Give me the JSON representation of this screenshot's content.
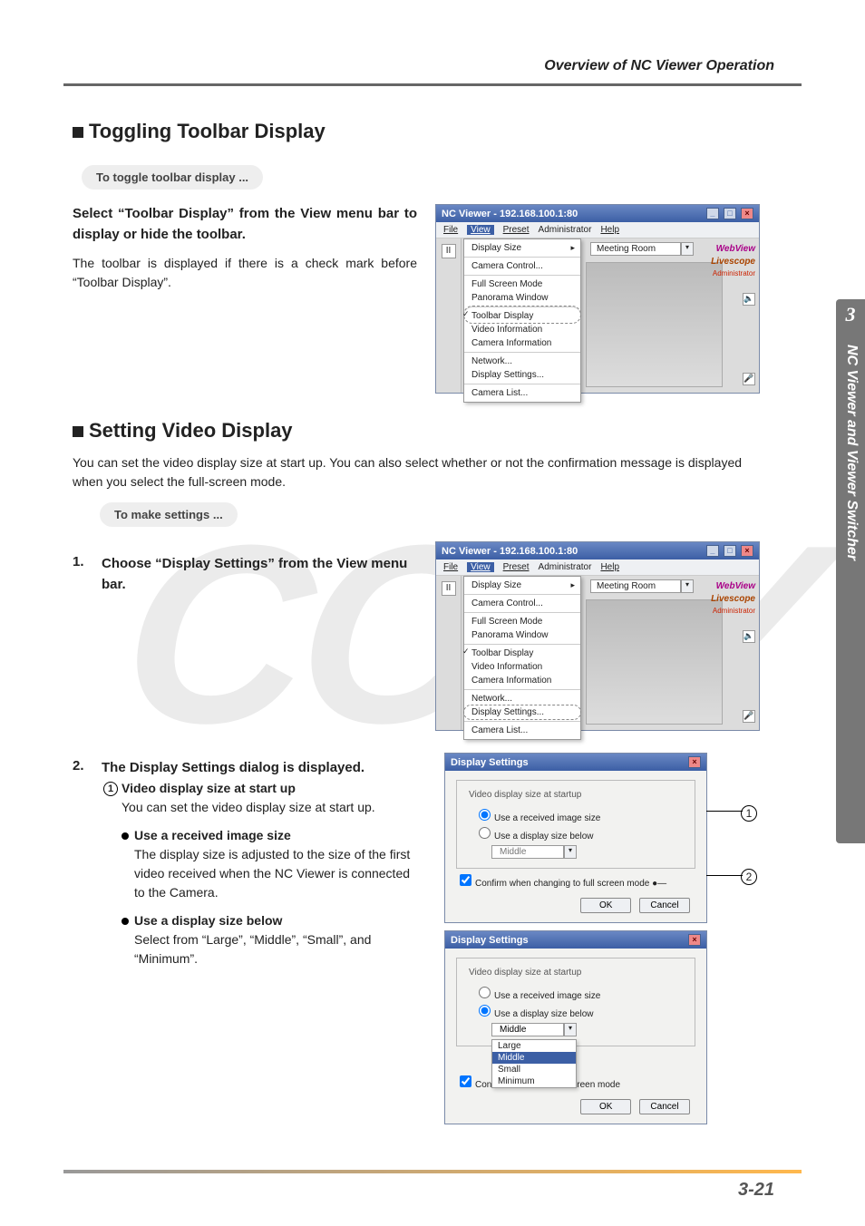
{
  "header": {
    "overview": "Overview of NC Viewer Operation"
  },
  "sideTab": {
    "chapter": "3",
    "label": "NC Viewer and Viewer Switcher"
  },
  "pageNum": "3-21",
  "section1": {
    "title": "Toggling Toolbar Display",
    "pill": "To toggle toolbar display ...",
    "strong": "Select “Toolbar Display” from the View menu bar to display or hide the toolbar.",
    "body": "The toolbar is displayed if there is a check mark before “Toolbar Display”."
  },
  "section2": {
    "title": "Setting Video Display",
    "intro": "You can set the video display size at start up. You can also select whether or not the confirmation message is displayed when you select the full-screen mode.",
    "pill": "To make settings ...",
    "step1_n": "1.",
    "step1": "Choose “Display Settings” from the View menu bar.",
    "step2_n": "2.",
    "step2": "The Display Settings dialog is displayed.",
    "sub1_label": "Video display size at start up",
    "sub1_body": "You can set the video display size at start up.",
    "bulletA_label": "Use a received image size",
    "bulletA_body": "The display size is adjusted to the size of the first video received when the NC Viewer is connected to the Camera.",
    "bulletB_label": "Use a display size below",
    "bulletB_body": "Select from “Large”, “Middle”, “Small”, and “Minimum”."
  },
  "win": {
    "title": "NC Viewer - 192.168.100.1:80",
    "menu": {
      "file": "File",
      "view": "View",
      "preset": "Preset",
      "admin": "Administrator",
      "help": "Help"
    },
    "camera": "Meeting Room",
    "brand1": "WebView",
    "brand2": "Livescope",
    "brand3": "Administrator",
    "items": {
      "displaySize": "Display Size",
      "cameraControl": "Camera Control...",
      "fullScreen": "Full Screen Mode",
      "panorama": "Panorama Window",
      "toolbar": "Toolbar Display",
      "videoInfo": "Video Information",
      "cameraInfo": "Camera Information",
      "network": "Network...",
      "dispSettings": "Display Settings...",
      "cameraList": "Camera List..."
    }
  },
  "dlg": {
    "title": "Display Settings",
    "legend": "Video display size at startup",
    "optA": "Use a received image size",
    "optB": "Use a display size below",
    "sizeSel": "Middle",
    "sizes": [
      "Large",
      "Middle",
      "Small",
      "Minimum"
    ],
    "confirm": "Confirm when changing to full screen mode",
    "ok": "OK",
    "cancel": "Cancel"
  },
  "callout": {
    "c1": "1",
    "c2": "2"
  }
}
